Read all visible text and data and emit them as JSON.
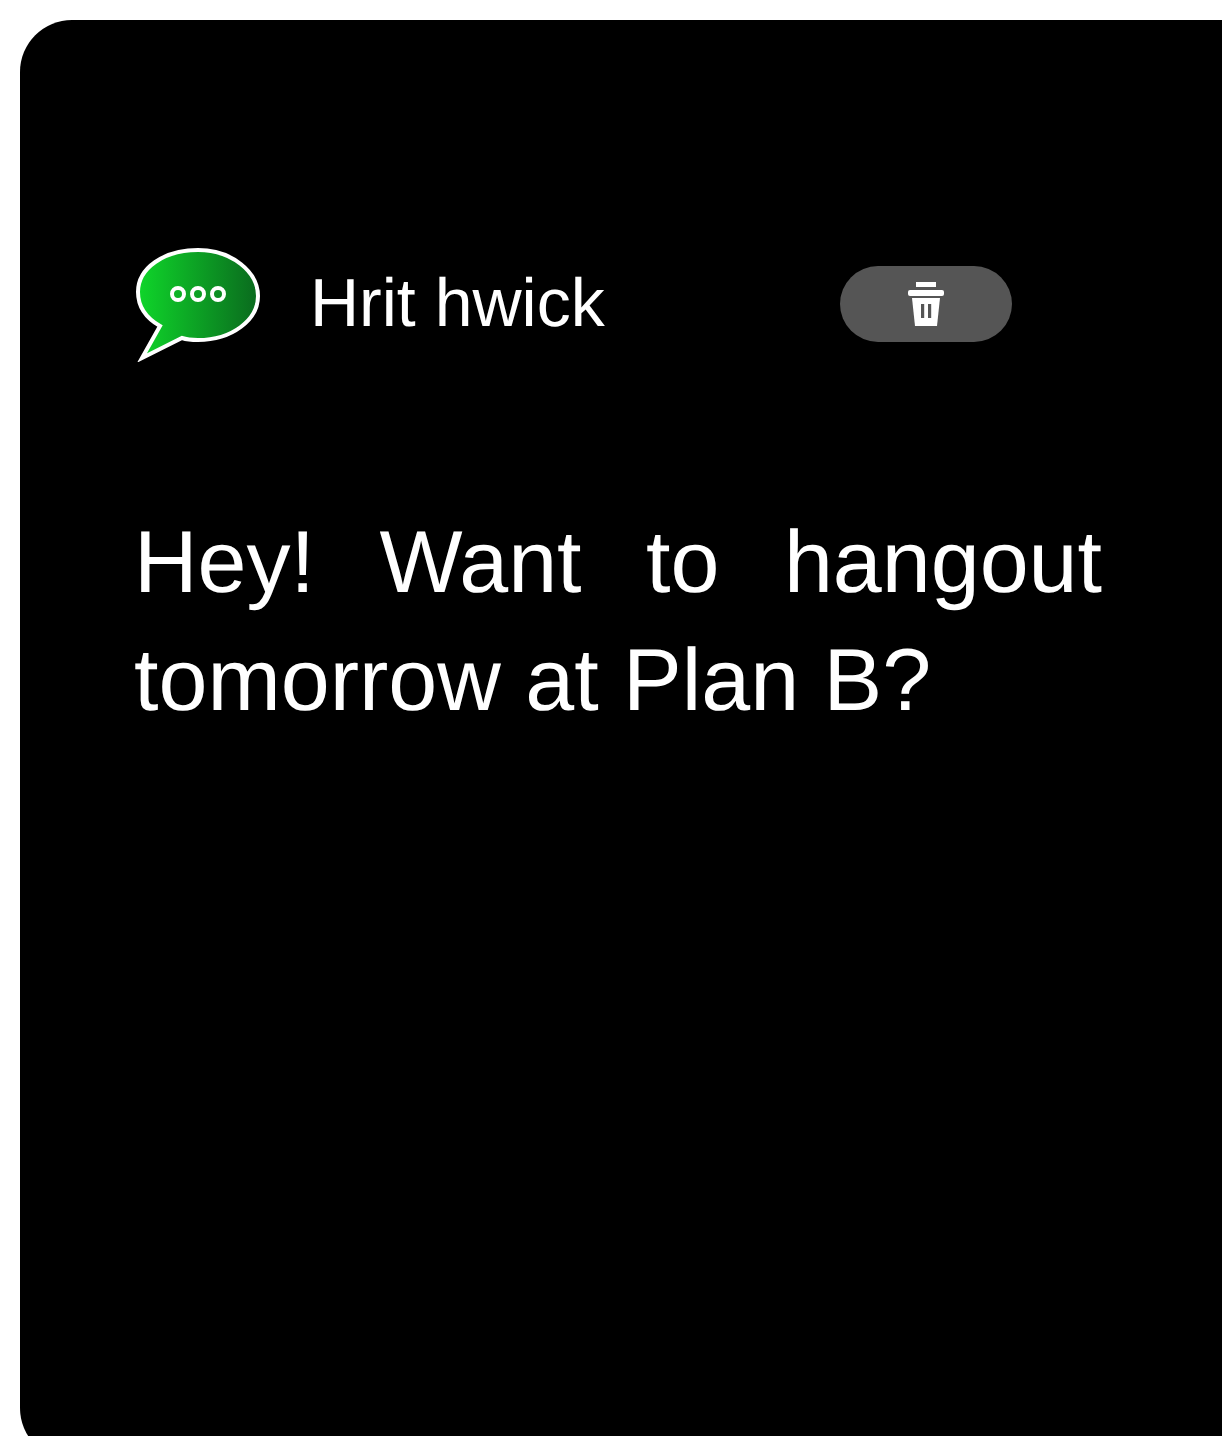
{
  "notification": {
    "sender": "Hrit hwick",
    "message": "Hey! Want to hangout tomorrow at Plan B?"
  }
}
